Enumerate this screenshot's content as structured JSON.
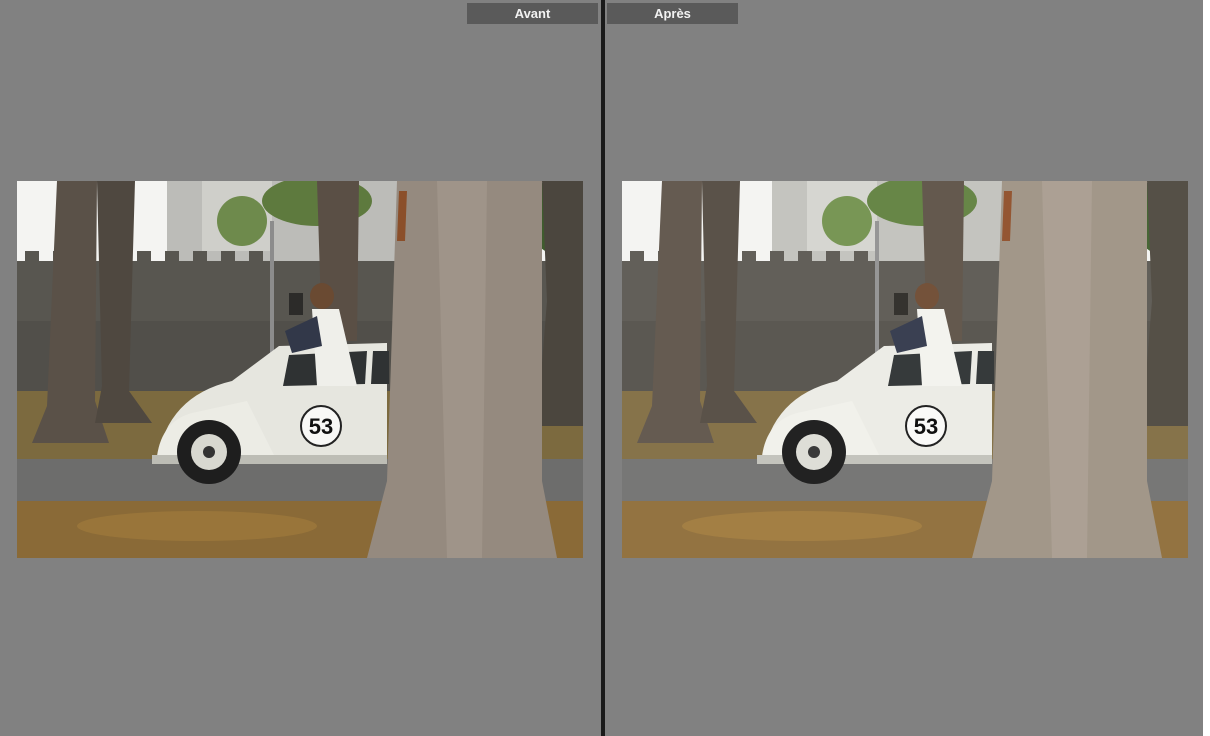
{
  "compare_view": {
    "before": {
      "label": "Avant"
    },
    "after": {
      "label": "Après"
    }
  },
  "photo": {
    "car_number": "53"
  },
  "colors": {
    "background": "#818181",
    "divider": "#1a1a1a",
    "label_bg": "#5a5a5a",
    "label_text": "#f2f2f2"
  }
}
